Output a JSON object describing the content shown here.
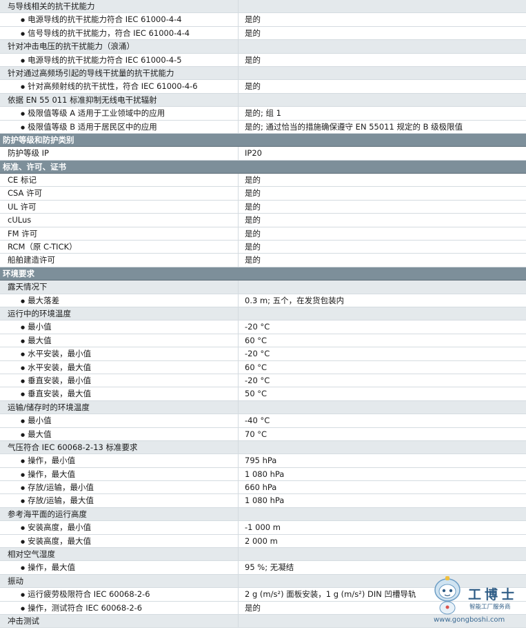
{
  "rows": [
    {
      "kind": "group",
      "label": "与导线相关的抗干扰能力",
      "value": ""
    },
    {
      "kind": "item",
      "label": "电源导线的抗干扰能力符合 IEC 61000-4-4",
      "value": "是的"
    },
    {
      "kind": "item",
      "label": "信号导线的抗干扰能力，符合 IEC 61000-4-4",
      "value": "是的"
    },
    {
      "kind": "group",
      "label": "针对冲击电压的抗干扰能力（浪涌）",
      "value": ""
    },
    {
      "kind": "item",
      "label": "电源导线的抗干扰能力符合 IEC 61000-4-5",
      "value": "是的"
    },
    {
      "kind": "group",
      "label": "针对通过高频场引起的导线干扰量的抗干扰能力",
      "value": ""
    },
    {
      "kind": "item",
      "label": "针对高频射线的抗干扰性，符合 IEC 61000-4-6",
      "value": "是的"
    },
    {
      "kind": "group",
      "label": "依据 EN 55 011 标准抑制无线电干扰辐射",
      "value": ""
    },
    {
      "kind": "item",
      "label": "极限值等级 A 适用于工业领域中的应用",
      "value": "是的; 组 1"
    },
    {
      "kind": "item",
      "label": "极限值等级 B 适用于居民区中的应用",
      "value": "是的; 通过恰当的措施确保遵守 EN 55011 规定的 B 级极限值"
    },
    {
      "kind": "category",
      "label": "防护等级和防护类别",
      "value": ""
    },
    {
      "kind": "plain",
      "label": "防护等级 IP",
      "value": "IP20"
    },
    {
      "kind": "category",
      "label": "标准、许可、证书",
      "value": ""
    },
    {
      "kind": "plain",
      "label": "CE 标记",
      "value": "是的"
    },
    {
      "kind": "plain",
      "label": "CSA 许可",
      "value": "是的"
    },
    {
      "kind": "plain",
      "label": "UL 许可",
      "value": "是的"
    },
    {
      "kind": "plain",
      "label": "cULus",
      "value": "是的"
    },
    {
      "kind": "plain",
      "label": "FM 许可",
      "value": "是的"
    },
    {
      "kind": "plain",
      "label": "RCM（原 C-TICK）",
      "value": "是的"
    },
    {
      "kind": "plain",
      "label": "船舶建造许可",
      "value": "是的"
    },
    {
      "kind": "category",
      "label": "环境要求",
      "value": ""
    },
    {
      "kind": "group",
      "label": "露天情况下",
      "value": ""
    },
    {
      "kind": "item",
      "label": "最大落差",
      "value": "0.3 m; 五个，在发货包装内"
    },
    {
      "kind": "group",
      "label": "运行中的环境温度",
      "value": ""
    },
    {
      "kind": "item",
      "label": "最小值",
      "value": "-20 °C"
    },
    {
      "kind": "item",
      "label": "最大值",
      "value": "60 °C"
    },
    {
      "kind": "item",
      "label": "水平安装，最小值",
      "value": "-20 °C"
    },
    {
      "kind": "item",
      "label": "水平安装，最大值",
      "value": "60 °C"
    },
    {
      "kind": "item",
      "label": "垂直安装，最小值",
      "value": "-20 °C"
    },
    {
      "kind": "item",
      "label": "垂直安装，最大值",
      "value": "50 °C"
    },
    {
      "kind": "group",
      "label": "运输/储存时的环境温度",
      "value": ""
    },
    {
      "kind": "item",
      "label": "最小值",
      "value": "-40 °C"
    },
    {
      "kind": "item",
      "label": "最大值",
      "value": "70 °C"
    },
    {
      "kind": "group",
      "label": "气压符合 IEC 60068-2-13 标准要求",
      "value": ""
    },
    {
      "kind": "item",
      "label": "操作，最小值",
      "value": "795 hPa"
    },
    {
      "kind": "item",
      "label": "操作，最大值",
      "value": "1 080 hPa"
    },
    {
      "kind": "item",
      "label": "存放/运输，最小值",
      "value": "660 hPa"
    },
    {
      "kind": "item",
      "label": "存放/运输，最大值",
      "value": "1 080 hPa"
    },
    {
      "kind": "group",
      "label": "参考海平面的运行高度",
      "value": ""
    },
    {
      "kind": "item",
      "label": "安装高度，最小值",
      "value": "-1 000 m"
    },
    {
      "kind": "item",
      "label": "安装高度，最大值",
      "value": "2 000 m"
    },
    {
      "kind": "group",
      "label": "相对空气湿度",
      "value": ""
    },
    {
      "kind": "item",
      "label": "操作，最大值",
      "value": "95 %; 无凝结"
    },
    {
      "kind": "group",
      "label": "振动",
      "value": ""
    },
    {
      "kind": "item",
      "label": "运行疲劳极限符合 IEC 60068-2-6",
      "value": "2 g (m/s²) 面板安装，1 g (m/s²) DIN 凹槽导轨"
    },
    {
      "kind": "item",
      "label": "操作，测试符合 IEC 60068-2-6",
      "value": "是的"
    },
    {
      "kind": "group",
      "label": "冲击测试",
      "value": ""
    }
  ],
  "watermark": {
    "brand": "工博士",
    "tagline": "智能工厂服务商",
    "url": "www.gongboshi.com"
  }
}
